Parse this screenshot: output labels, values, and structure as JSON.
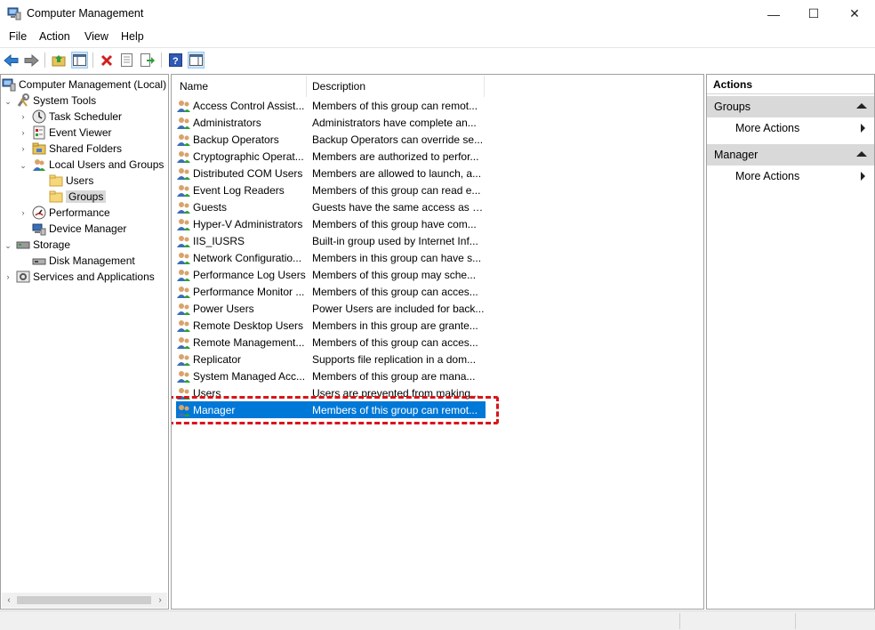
{
  "window": {
    "title": "Computer Management",
    "minimize_glyph": "—",
    "maximize_glyph": "☐",
    "close_glyph": "✕"
  },
  "menu": {
    "items": [
      "File",
      "Action",
      "View",
      "Help"
    ]
  },
  "toolbar": {
    "buttons": [
      "back-arrow-icon",
      "forward-arrow-icon",
      "up-folder-icon",
      "show-hide-tree-icon",
      "delete-icon",
      "properties-icon",
      "export-list-icon",
      "help-icon",
      "show-hide-action-pane-icon"
    ]
  },
  "tree": {
    "root": "Computer Management (Local)",
    "system_tools": "System Tools",
    "task_scheduler": "Task Scheduler",
    "event_viewer": "Event Viewer",
    "shared_folders": "Shared Folders",
    "local_users_groups": "Local Users and Groups",
    "users": "Users",
    "groups": "Groups",
    "performance": "Performance",
    "device_manager": "Device Manager",
    "storage": "Storage",
    "disk_management": "Disk Management",
    "services_apps": "Services and Applications"
  },
  "list": {
    "columns": {
      "name": "Name",
      "description": "Description"
    },
    "rows": [
      {
        "name": "Access Control Assist...",
        "description": "Members of this group can remot..."
      },
      {
        "name": "Administrators",
        "description": "Administrators have complete an..."
      },
      {
        "name": "Backup Operators",
        "description": "Backup Operators can override se..."
      },
      {
        "name": "Cryptographic Operat...",
        "description": "Members are authorized to perfor..."
      },
      {
        "name": "Distributed COM Users",
        "description": "Members are allowed to launch, a..."
      },
      {
        "name": "Event Log Readers",
        "description": "Members of this group can read e..."
      },
      {
        "name": "Guests",
        "description": "Guests have the same access as m..."
      },
      {
        "name": "Hyper-V Administrators",
        "description": "Members of this group have com..."
      },
      {
        "name": "IIS_IUSRS",
        "description": "Built-in group used by Internet Inf..."
      },
      {
        "name": "Network Configuratio...",
        "description": "Members in this group can have s..."
      },
      {
        "name": "Performance Log Users",
        "description": "Members of this group may sche..."
      },
      {
        "name": "Performance Monitor ...",
        "description": "Members of this group can acces..."
      },
      {
        "name": "Power Users",
        "description": "Power Users are included for back..."
      },
      {
        "name": "Remote Desktop Users",
        "description": "Members in this group are grante..."
      },
      {
        "name": "Remote Management...",
        "description": "Members of this group can acces..."
      },
      {
        "name": "Replicator",
        "description": "Supports file replication in a dom..."
      },
      {
        "name": "System Managed Acc...",
        "description": "Members of this group are mana..."
      },
      {
        "name": "Users",
        "description": "Users are prevented from making..."
      },
      {
        "name": "Manager",
        "description": "Members of this group can remot..."
      }
    ],
    "selected_row": "Manager",
    "highlight_color": "#d9141a",
    "selection_color": "#0078d7"
  },
  "actions": {
    "header": "Actions",
    "sections": [
      {
        "title": "Groups",
        "item": "More Actions"
      },
      {
        "title": "Manager",
        "item": "More Actions"
      }
    ]
  }
}
